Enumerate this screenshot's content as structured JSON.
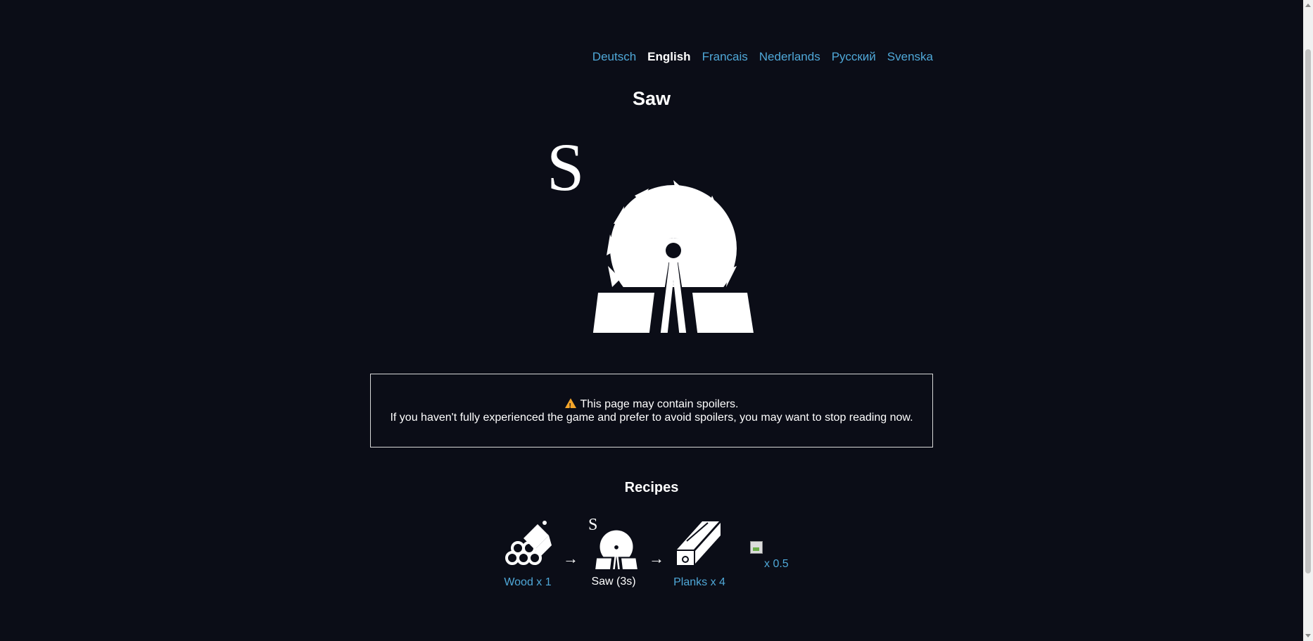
{
  "languages": [
    {
      "label": "Deutsch",
      "active": false
    },
    {
      "label": "English",
      "active": true
    },
    {
      "label": "Francais",
      "active": false
    },
    {
      "label": "Nederlands",
      "active": false
    },
    {
      "label": "Русский",
      "active": false
    },
    {
      "label": "Svenska",
      "active": false
    }
  ],
  "page": {
    "title": "Saw",
    "hero_letter": "S",
    "hero_icon": "saw-icon"
  },
  "spoiler": {
    "line1": "This page may contain spoilers.",
    "line2": "If you haven't fully experienced the game and prefer to avoid spoilers, you may want to stop reading now.",
    "icon": "warning-icon",
    "icon_color": "#f4a52a"
  },
  "recipes": {
    "title": "Recipes",
    "items": [
      {
        "icon": "wood-icon",
        "label": "Wood x 1"
      },
      {
        "icon": "saw-icon",
        "letter": "S",
        "label": "Saw (3s)"
      },
      {
        "icon": "planks-icon",
        "label": "Planks x 4"
      }
    ],
    "arrow": "→",
    "extra": {
      "icon": "broken-image-icon",
      "label": "x 0.5"
    }
  },
  "colors": {
    "background": "#0b0d17",
    "link": "#4fa8d8",
    "text": "#ffffff"
  }
}
